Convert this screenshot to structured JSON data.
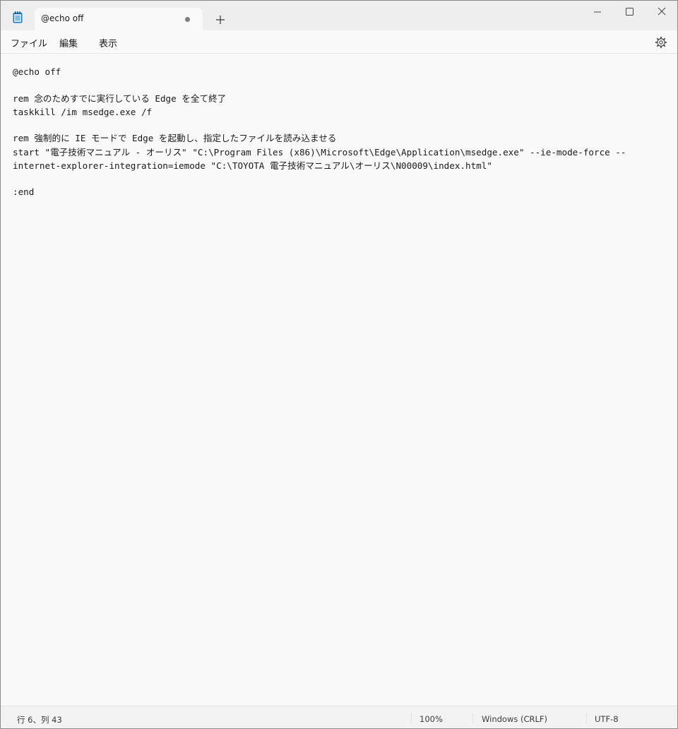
{
  "window": {
    "tab_title": "@echo off",
    "new_tab_icon": "plus-icon",
    "app_icon": "notepad-icon",
    "controls": [
      "minimize-icon",
      "maximize-icon",
      "close-icon"
    ]
  },
  "menu": {
    "file": "ファイル",
    "edit": "編集",
    "view": "表示",
    "settings_icon": "gear-icon"
  },
  "editor": {
    "lines": [
      "@echo off",
      "rem 念のためすでに実行している Edge を全て終了",
      "taskkill /im msedge.exe /f",
      "rem 強制的に IE モードで Edge を起動し、指定したファイルを読み込ませる",
      "start \"電子技術マニュアル - オーリス\" \"C:\\Program Files (x86)\\Microsoft\\Edge\\Application\\msedge.exe\" --ie-mode-force --",
      "internet-explorer-integration=iemode \"C:\\TOYOTA 電子技術マニュアル\\オーリス\\N00009\\index.html\"",
      ":end"
    ]
  },
  "status": {
    "position": "行 6、列 43",
    "zoom": "100%",
    "line_ending": "Windows (CRLF)",
    "encoding": "UTF-8"
  },
  "colors": {
    "accent": "#0078d4",
    "title_bar": "#eeeeee",
    "editor_bg": "#f9f9f9"
  }
}
